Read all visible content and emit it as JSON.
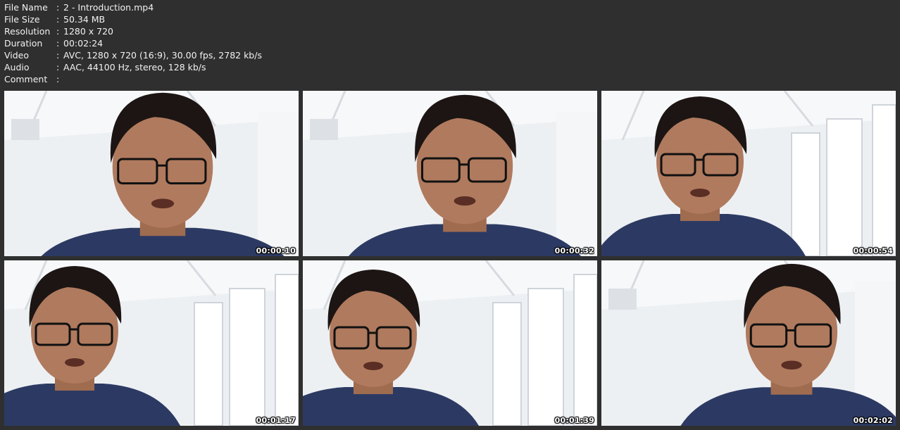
{
  "info": [
    {
      "label": "File Name",
      "value": "2 - Introduction.mp4"
    },
    {
      "label": "File Size",
      "value": "50.34 MB"
    },
    {
      "label": "Resolution",
      "value": "1280 x 720"
    },
    {
      "label": "Duration",
      "value": "00:02:24"
    },
    {
      "label": "Video",
      "value": "AVC, 1280 x 720 (16:9), 30.00 fps, 2782 kb/s"
    },
    {
      "label": "Audio",
      "value": "AAC, 44100 Hz, stereo, 128 kb/s"
    },
    {
      "label": "Comment",
      "value": ""
    }
  ],
  "separator": ":",
  "thumbnails": [
    {
      "timestamp": "00:00:10"
    },
    {
      "timestamp": "00:00:32"
    },
    {
      "timestamp": "00:00:54"
    },
    {
      "timestamp": "00:01:17"
    },
    {
      "timestamp": "00:01:39"
    },
    {
      "timestamp": "00:02:02"
    }
  ],
  "colors": {
    "background": "#2f2f2f",
    "wall": "#e9ecef",
    "shirt": "#2c3a63",
    "skin": "#b07a5e",
    "hair": "#1c1513"
  }
}
